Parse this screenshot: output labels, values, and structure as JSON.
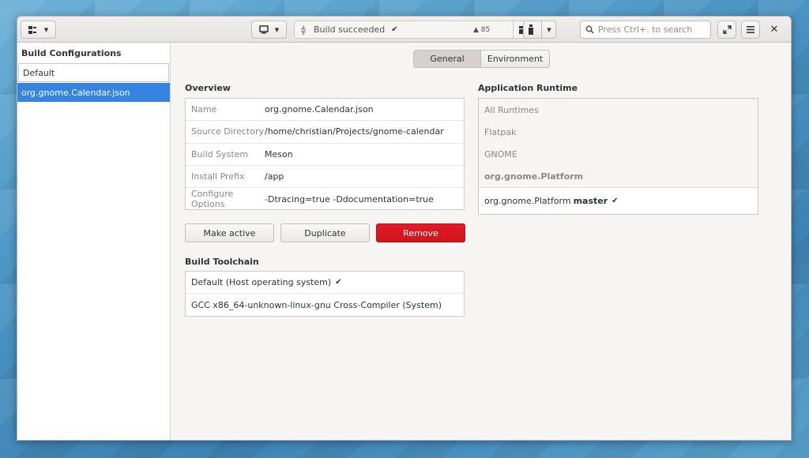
{
  "status": {
    "message": "Build succeeded",
    "warning_count": "85"
  },
  "search": {
    "placeholder": "Press Ctrl+. to search"
  },
  "sidebar": {
    "title": "Build Configurations",
    "items": [
      {
        "label": "Default"
      },
      {
        "label": "org.gnome.Calendar.json"
      }
    ]
  },
  "tabs": [
    {
      "label": "General"
    },
    {
      "label": "Environment"
    }
  ],
  "overview": {
    "title": "Overview",
    "rows": [
      {
        "key": "Name",
        "value": "org.gnome.Calendar.json"
      },
      {
        "key": "Source Directory",
        "value": "/home/christian/Projects/gnome-calendar"
      },
      {
        "key": "Build System",
        "value": "Meson"
      },
      {
        "key": "Install Prefix",
        "value": "/app"
      },
      {
        "key": "Configure Options",
        "value": "-Dtracing=true -Ddocumentation=true"
      }
    ]
  },
  "actions": {
    "make_active": "Make active",
    "duplicate": "Duplicate",
    "remove": "Remove"
  },
  "toolchain": {
    "title": "Build Toolchain",
    "items": [
      {
        "label": "Default (Host operating system)"
      },
      {
        "label": "GCC x86_64-unknown-linux-gnu Cross-Compiler (System)"
      }
    ]
  },
  "runtime": {
    "title": "Application Runtime",
    "items": [
      {
        "label": "All Runtimes"
      },
      {
        "label": "Flatpak"
      },
      {
        "label": "GNOME"
      },
      {
        "label": "org.gnome.Platform"
      }
    ],
    "selected": {
      "name": "org.gnome.Platform",
      "branch": "master"
    }
  }
}
